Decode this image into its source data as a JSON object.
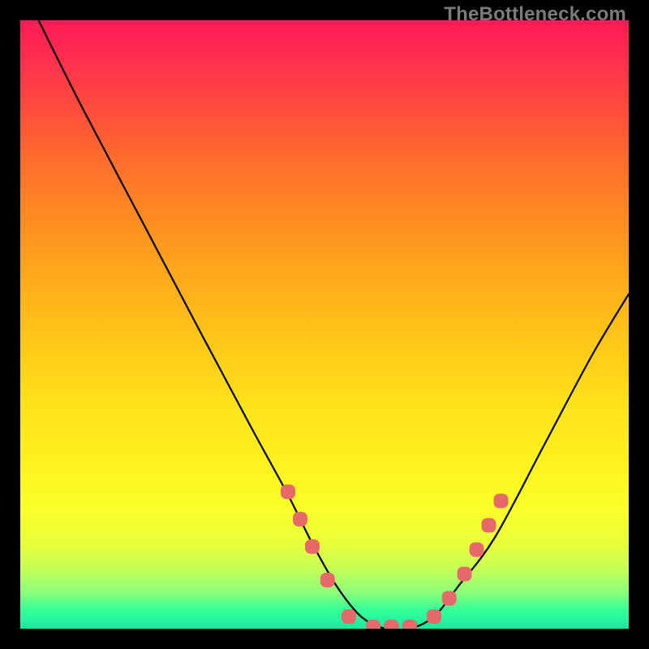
{
  "watermark": "TheBottleneck.com",
  "chart_data": {
    "type": "line",
    "title": "",
    "xlabel": "",
    "ylabel": "",
    "xlim": [
      0,
      100
    ],
    "ylim": [
      0,
      100
    ],
    "series": [
      {
        "name": "curve",
        "x": [
          3,
          10,
          20,
          30,
          38,
          44,
          48,
          52,
          56,
          60,
          64,
          68,
          72,
          78,
          86,
          94,
          100
        ],
        "y": [
          100,
          86,
          67,
          48,
          33,
          22,
          14,
          7,
          2,
          0,
          0,
          2,
          7,
          15,
          30,
          45,
          55
        ]
      }
    ],
    "markers": {
      "name": "dots",
      "color": "#e76a6a",
      "points": [
        {
          "x": 44.0,
          "y": 22.5
        },
        {
          "x": 46.0,
          "y": 18.0
        },
        {
          "x": 48.0,
          "y": 13.5
        },
        {
          "x": 50.5,
          "y": 8.0
        },
        {
          "x": 54.0,
          "y": 2.0
        },
        {
          "x": 58.0,
          "y": 0.3
        },
        {
          "x": 61.0,
          "y": 0.3
        },
        {
          "x": 64.0,
          "y": 0.3
        },
        {
          "x": 68.0,
          "y": 2.0
        },
        {
          "x": 70.5,
          "y": 5.0
        },
        {
          "x": 73.0,
          "y": 9.0
        },
        {
          "x": 75.0,
          "y": 13.0
        },
        {
          "x": 77.0,
          "y": 17.0
        },
        {
          "x": 79.0,
          "y": 21.0
        }
      ]
    }
  }
}
